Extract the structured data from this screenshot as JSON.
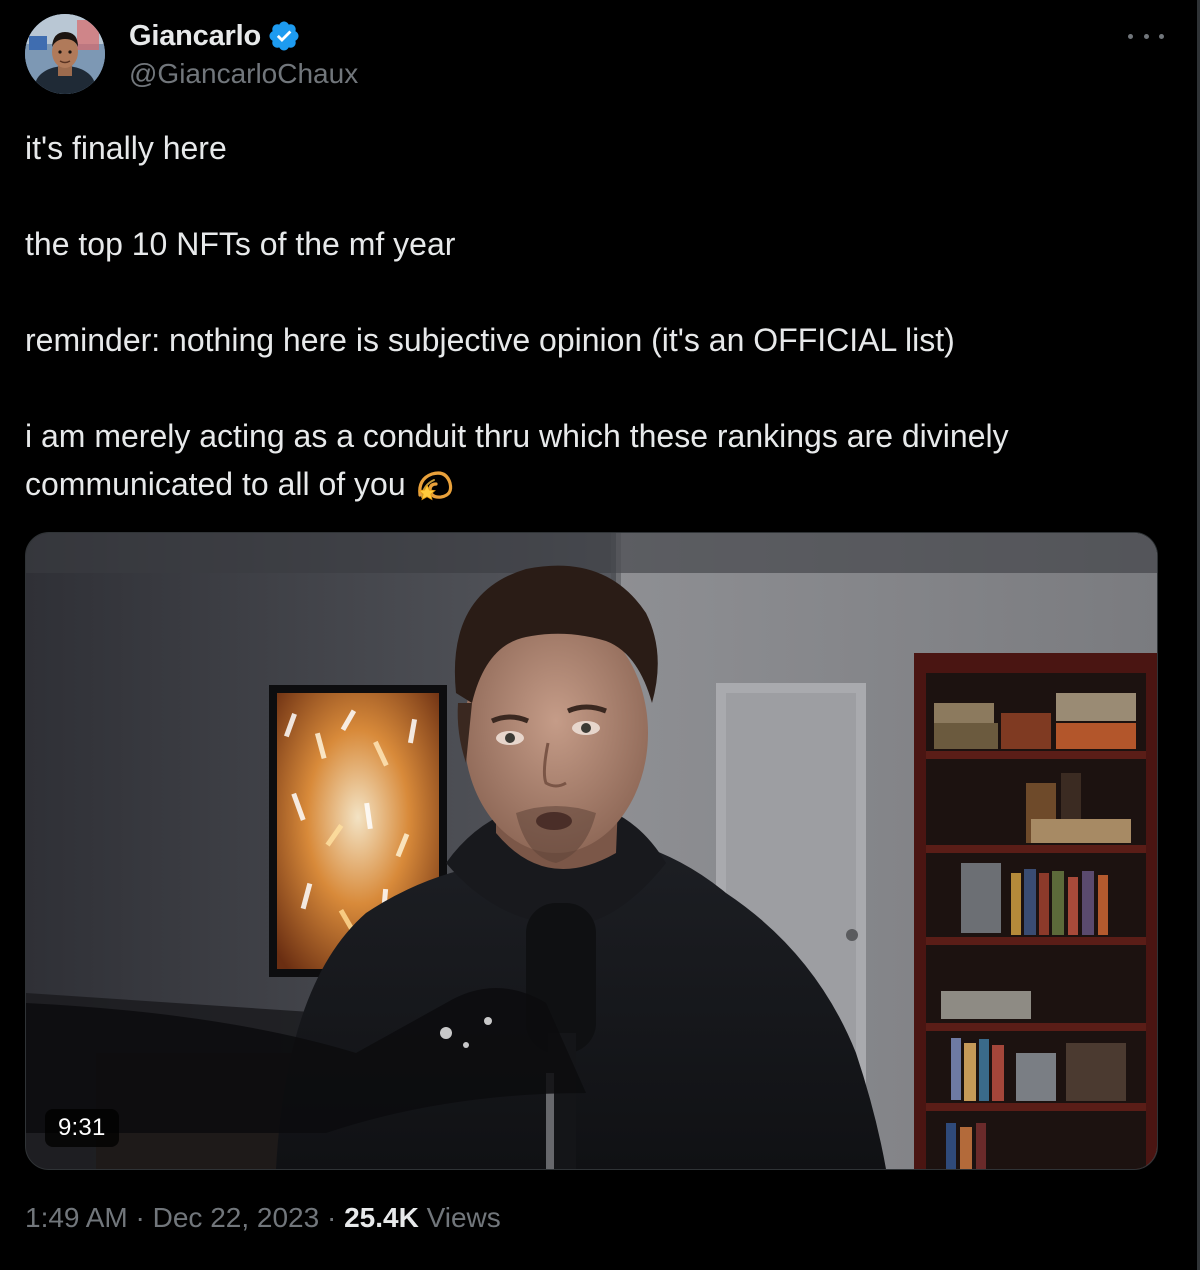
{
  "author": {
    "display_name": "Giancarlo",
    "handle": "@GiancarloChaux",
    "verified": true,
    "verified_color": "#1d9bf0"
  },
  "more_icon": "more-horizontal-icon",
  "tweet": {
    "paragraphs": [
      "it's finally here",
      "the top 10 NFTs of the mf year",
      "reminder: nothing here is subjective opinion (it's an OFFICIAL list)",
      "i am merely acting as a conduit thru which these rankings are divinely communicated to all of you"
    ],
    "trailing_emoji": "dizzy-emoji"
  },
  "media": {
    "kind": "video",
    "duration": "9:31"
  },
  "meta": {
    "time": "1:49 AM",
    "separator": "·",
    "date": "Dec 22, 2023",
    "views_count": "25.4K",
    "views_label": "Views"
  },
  "colors": {
    "background": "#000000",
    "text_primary": "#e7e9ea",
    "text_secondary": "#71767b",
    "border": "#2f3336"
  }
}
